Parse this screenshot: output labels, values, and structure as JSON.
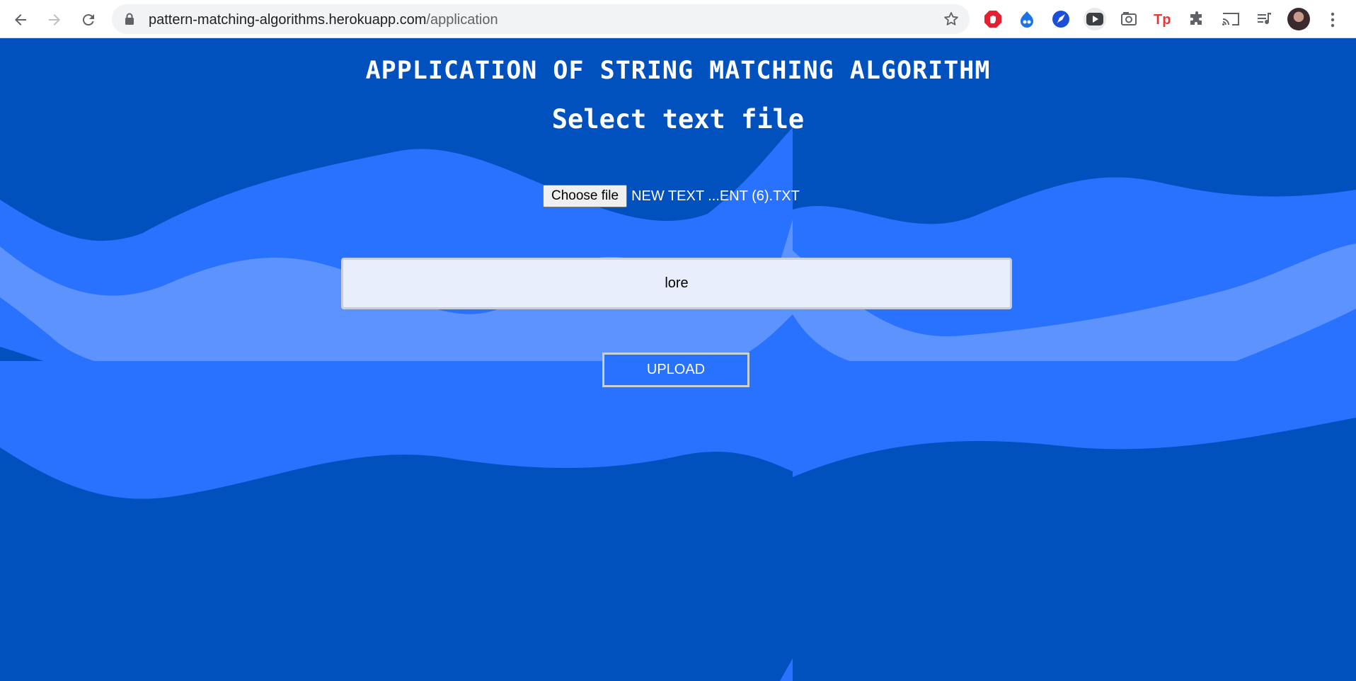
{
  "browser": {
    "url_domain": "pattern-matching-algorithms.herokuapp.com",
    "url_path": "/application",
    "extensions": [
      "adblock-icon",
      "extension-blue-icon",
      "rocket-icon",
      "youtube-icon",
      "screenshot-icon",
      "tp-icon",
      "puzzle-icon",
      "cast-icon",
      "media-queue-icon"
    ]
  },
  "page": {
    "title": "APPLICATION OF STRING MATCHING ALGORITHM",
    "subtitle": "Select text file",
    "choose_file_label": "Choose file",
    "selected_file": "NEW TEXT ...ENT (6).TXT",
    "pattern_value": "lore",
    "upload_label": "UPLOAD"
  },
  "colors": {
    "background": "#0050be",
    "wave_mid": "#2971ff",
    "wave_light": "#5c93ff",
    "text": "#ffffff"
  }
}
